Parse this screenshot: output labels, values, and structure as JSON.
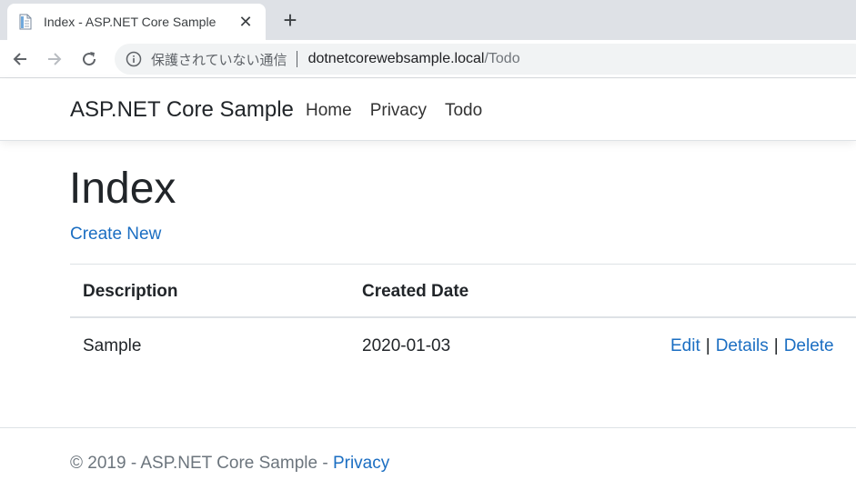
{
  "browser": {
    "tab_title": "Index - ASP.NET Core Sample",
    "close_glyph": "✕",
    "new_tab_glyph": "+",
    "security_label": "保護されていない通信",
    "url_host": "dotnetcorewebsample.local",
    "url_path": "/Todo"
  },
  "navbar": {
    "brand": "ASP.NET Core Sample",
    "links": [
      "Home",
      "Privacy",
      "Todo"
    ]
  },
  "main": {
    "heading": "Index",
    "create_link": "Create New",
    "table": {
      "headers": [
        "Description",
        "Created Date"
      ],
      "rows": [
        {
          "description": "Sample",
          "created_date": "2020-01-03",
          "actions": [
            "Edit",
            "Details",
            "Delete"
          ]
        }
      ]
    }
  },
  "footer": {
    "text": "© 2019 - ASP.NET Core Sample - ",
    "link": "Privacy"
  },
  "colors": {
    "link": "#1b6ec2",
    "tabstrip": "#dee1e6",
    "omnibox": "#f1f3f4"
  },
  "icons": [
    "document-favicon-icon",
    "close-icon",
    "plus-icon",
    "back-arrow-icon",
    "forward-arrow-icon",
    "reload-icon",
    "info-icon"
  ]
}
